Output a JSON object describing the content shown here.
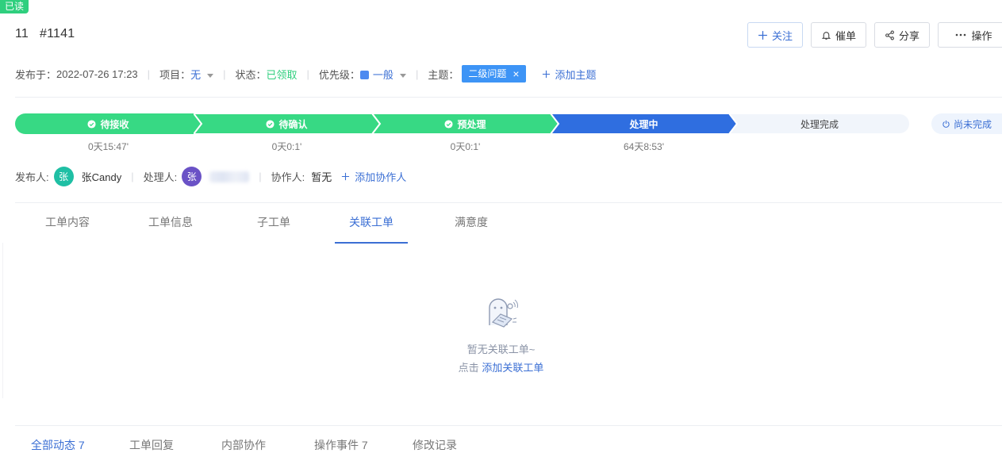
{
  "badge": "已读",
  "ticket": {
    "number": "11",
    "id": "#1141"
  },
  "actions": {
    "follow": "关注",
    "urge": "催单",
    "share": "分享",
    "operate": "操作"
  },
  "meta": {
    "published_label": "发布于：",
    "published_value": "2022-07-26 17:23",
    "project_label": "项目：",
    "project_value": "无",
    "status_label": "状态：",
    "status_value": "已领取",
    "priority_label": "优先级：",
    "priority_value": "一般",
    "topic_label": "主题：",
    "topic_tag": "二级问题",
    "topic_remove": "×",
    "add_topic": "添加主题"
  },
  "progress": {
    "steps": [
      {
        "label": "待接收",
        "duration": "0天15:47'",
        "state": "done"
      },
      {
        "label": "待确认",
        "duration": "0天0:1'",
        "state": "done"
      },
      {
        "label": "预处理",
        "duration": "0天0:1'",
        "state": "done"
      },
      {
        "label": "处理中",
        "duration": "64天8:53'",
        "state": "current"
      },
      {
        "label": "处理完成",
        "duration": "",
        "state": "pending"
      }
    ],
    "unfinished": "尚未完成",
    "colors": {
      "done": "#37d984",
      "current": "#2f6ee0",
      "pending": "#f1f5fb"
    }
  },
  "people": {
    "publisher_label": "发布人:",
    "publisher_avatar": "张",
    "publisher_name": "张Candy",
    "handler_label": "处理人:",
    "handler_avatar": "张",
    "collab_label": "协作人:",
    "collab_value": "暂无",
    "add_collab": "添加协作人"
  },
  "tabs": [
    {
      "label": "工单内容"
    },
    {
      "label": "工单信息"
    },
    {
      "label": "子工单"
    },
    {
      "label": "关联工单",
      "active": true
    },
    {
      "label": "满意度"
    }
  ],
  "empty": {
    "line1": "暂无关联工单~",
    "prefix": "点击",
    "link": "添加关联工单"
  },
  "bottom_tabs": [
    {
      "label": "全部动态 7",
      "active": true
    },
    {
      "label": "工单回复"
    },
    {
      "label": "内部协作"
    },
    {
      "label": "操作事件 7"
    },
    {
      "label": "修改记录"
    }
  ]
}
